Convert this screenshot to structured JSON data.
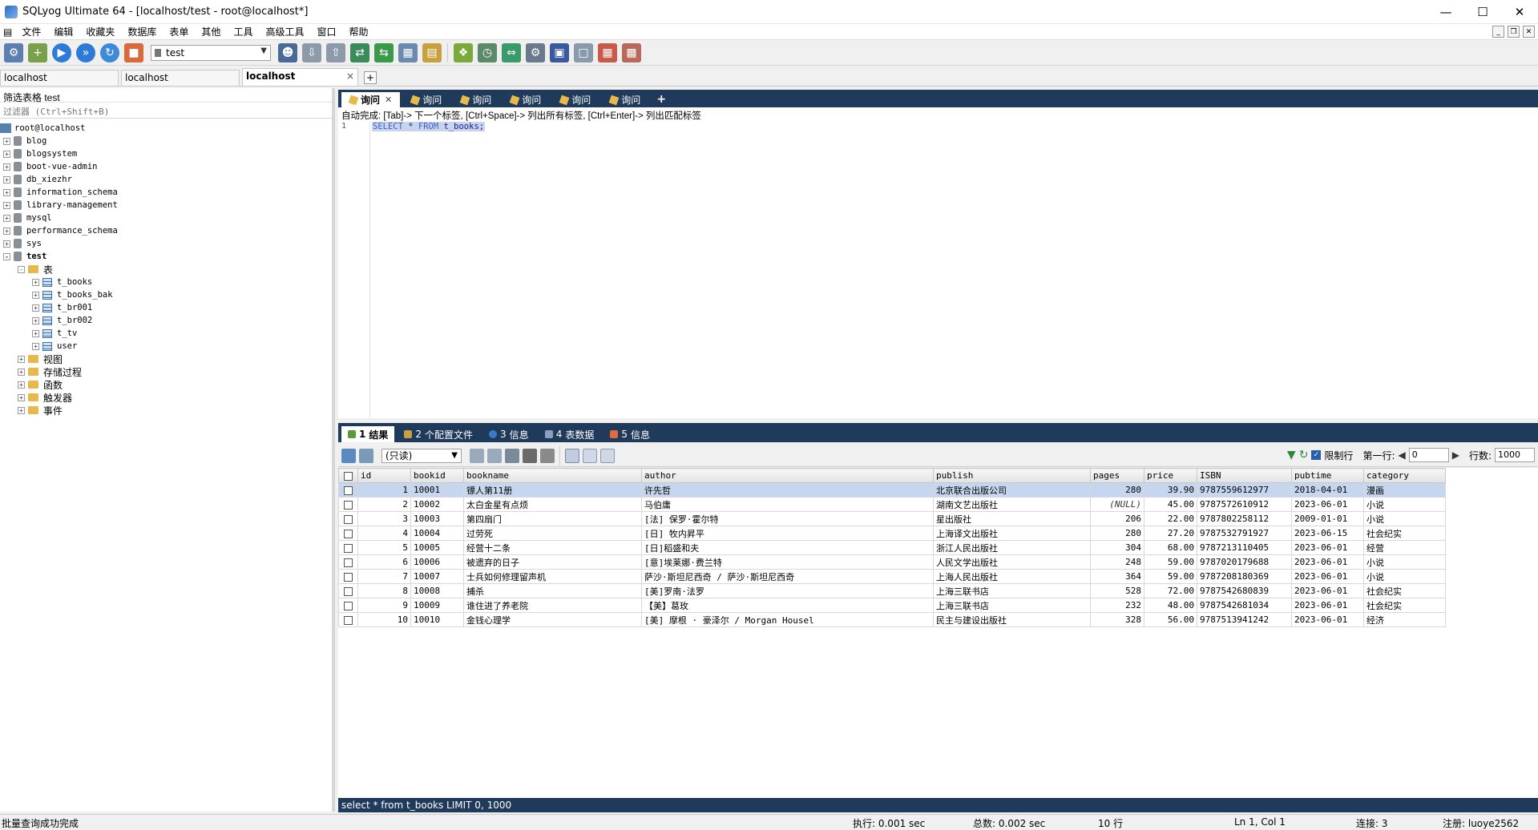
{
  "window": {
    "title": "SQLyog Ultimate 64 - [localhost/test - root@localhost*]"
  },
  "menu": [
    "文件",
    "编辑",
    "收藏夹",
    "数据库",
    "表单",
    "其他",
    "工具",
    "高级工具",
    "窗口",
    "帮助"
  ],
  "toolbar": {
    "database": "test"
  },
  "connection_tabs": [
    {
      "label": "localhost"
    },
    {
      "label": "localhost"
    },
    {
      "label": "localhost",
      "close": "×"
    }
  ],
  "object_browser": {
    "filter_label": "筛选表格 test",
    "filter_placeholder": "过滤器 (Ctrl+Shift+B)",
    "root": "root@localhost",
    "databases": [
      "blog",
      "blogsystem",
      "boot-vue-admin",
      "db_xiezhr",
      "information_schema",
      "library-management",
      "mysql",
      "performance_schema",
      "sys"
    ],
    "active_db": "test",
    "tables_folder": "表",
    "tables": [
      "t_books",
      "t_books_bak",
      "t_br001",
      "t_br002",
      "t_tv",
      "user"
    ],
    "folders": [
      "视图",
      "存储过程",
      "函数",
      "触发器",
      "事件"
    ]
  },
  "query_tabs": [
    "询问",
    "询问",
    "询问",
    "询问",
    "询问",
    "询问"
  ],
  "editor": {
    "hint": "自动完成: [Tab]-> 下一个标签, [Ctrl+Space]-> 列出所有标签, [Ctrl+Enter]-> 列出匹配标签",
    "line_number": "1",
    "sql_kw1": "SELECT",
    "sql_star": " * ",
    "sql_kw2": "FROM",
    "sql_rest": " t_books;"
  },
  "result_tabs": [
    {
      "num": "1",
      "label": "结果"
    },
    {
      "num": "2",
      "label": "个配置文件"
    },
    {
      "num": "3",
      "label": "信息"
    },
    {
      "num": "4",
      "label": "表数据"
    },
    {
      "num": "5",
      "label": "信息"
    }
  ],
  "result_toolbar": {
    "mode": "(只读)",
    "limit_label": "限制行",
    "first_row_label": "第一行:",
    "first_row": "0",
    "rows_label": "行数:",
    "rows": "1000"
  },
  "grid": {
    "columns": [
      "id",
      "bookid",
      "bookname",
      "author",
      "publish",
      "pages",
      "price",
      "ISBN",
      "pubtime",
      "category"
    ],
    "rows": [
      [
        "1",
        "10001",
        "镖人第11册",
        "许先哲",
        "北京联合出版公司",
        "280",
        "39.90",
        "9787559612977",
        "2018-04-01",
        "漫画"
      ],
      [
        "2",
        "10002",
        "太白金星有点烦",
        "马伯庸",
        " 湖南文艺出版社",
        "(NULL)",
        "45.00",
        " 9787572610912",
        "2023-06-01",
        "小说"
      ],
      [
        "3",
        "10003",
        "第四扇门",
        "[法] 保罗·霍尔特",
        "星出版社",
        "206",
        "22.00",
        "9787802258112",
        "2009-01-01",
        "小说"
      ],
      [
        "4",
        "10004",
        "过劳死",
        "[日] 牧内昇平",
        " 上海译文出版社",
        "280",
        "27.20",
        "9787532791927",
        "2023-06-15",
        "社会纪实"
      ],
      [
        "5",
        "10005",
        "经营十二条",
        "[日]稻盛和夫",
        "浙江人民出版社",
        "304",
        "68.00",
        "9787213110405",
        "2023-06-01",
        "经营"
      ],
      [
        "6",
        "10006",
        "被遗弃的日子",
        "[意]埃莱娜·费兰特",
        "人民文学出版社",
        "248",
        "59.00",
        "9787020179688",
        "2023-06-01",
        "小说"
      ],
      [
        "7",
        "10007",
        "士兵如何修理留声机",
        "萨沙·斯坦尼西奇 / 萨沙·斯坦尼西奇",
        "上海人民出版社",
        "364",
        "59.00",
        "9787208180369",
        "2023-06-01",
        "小说"
      ],
      [
        "8",
        "10008",
        "捕杀",
        "[美]罗南·法罗",
        "上海三联书店",
        "528",
        "72.00",
        "9787542680839",
        "2023-06-01",
        "社会纪实"
      ],
      [
        "9",
        "10009",
        "谁住进了养老院",
        "【美】葛玫",
        "上海三联书店",
        "232",
        "48.00",
        "9787542681034",
        "2023-06-01",
        "社会纪实"
      ],
      [
        "10",
        "10010",
        "金钱心理学",
        "[美] 摩根 · 豪泽尔 / Morgan Housel",
        " 民主与建设出版社",
        "328",
        "56.00",
        "9787513941242",
        "2023-06-01",
        "经济"
      ]
    ]
  },
  "sql_status": "select * from t_books LIMIT 0, 1000",
  "statusbar": {
    "message": "批量查询成功完成",
    "exec": "执行: 0.001 sec",
    "total": "总数: 0.002 sec",
    "rows": "10 行",
    "position": "Ln 1, Col 1",
    "connections": "连接: 3",
    "registered": "注册: luoye2562"
  }
}
